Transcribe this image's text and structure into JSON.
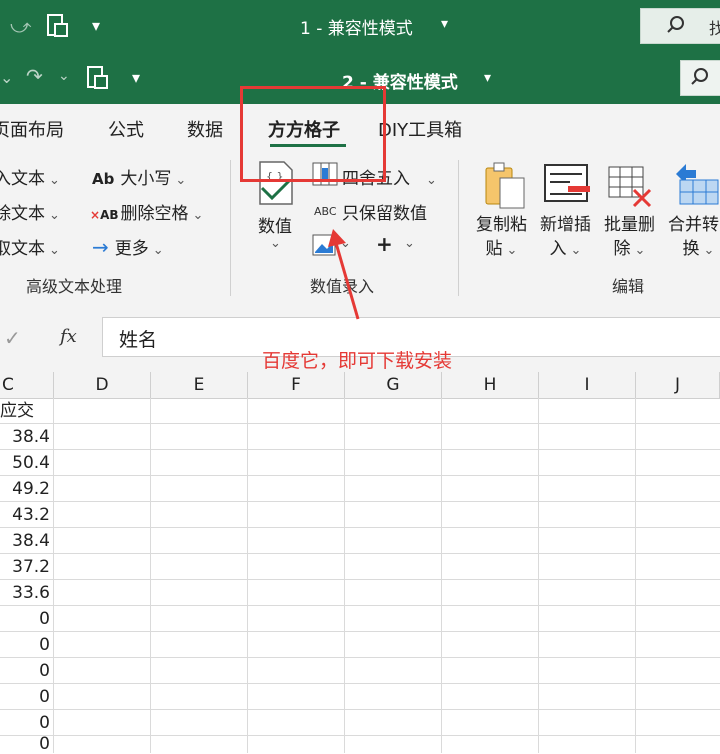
{
  "window1": {
    "title": "1  -  兼容性模式",
    "title_caret": "▾"
  },
  "window2": {
    "title": "2  -  兼容性模式",
    "title_caret": "▾"
  },
  "ribbon_tabs": [
    "页面布局",
    "公式",
    "数据",
    "方方格子",
    "DIY工具箱"
  ],
  "active_tab": "方方格子",
  "text_group": {
    "items": [
      "入文本",
      "除文本",
      "取文本"
    ],
    "items2": [
      "大小写",
      "删除空格",
      "更多"
    ],
    "icon_labels": [
      "Ab",
      "AB"
    ],
    "label": "高级文本处理"
  },
  "number_group": {
    "big_button": "数值",
    "items": [
      "四舍五入",
      "只保留数值"
    ],
    "abc_icon": "ABC",
    "plus_button": "+",
    "label": "数值录入"
  },
  "edit_group": {
    "buttons": [
      {
        "line1": "复制粘",
        "line2": "贴"
      },
      {
        "line1": "新增插",
        "line2": "入"
      },
      {
        "line1": "批量删",
        "line2": "除"
      },
      {
        "line1": "合并转",
        "line2": "换"
      }
    ],
    "label": "编辑"
  },
  "formula_bar": {
    "fx": "fx",
    "content": "姓名",
    "check": "✓"
  },
  "columns": [
    "C",
    "D",
    "E",
    "F",
    "G",
    "H",
    "I",
    "J"
  ],
  "column_c_header": "应交",
  "column_c_values": [
    "38.4",
    "50.4",
    "49.2",
    "43.2",
    "38.4",
    "37.2",
    "33.6",
    "0",
    "0",
    "0",
    "0",
    "0",
    "0"
  ],
  "annotation": "百度它，即可下载安装",
  "colors": {
    "excel_green": "#1e7145",
    "highlight_red": "#e53935",
    "tab_underline": "#1e7145"
  }
}
